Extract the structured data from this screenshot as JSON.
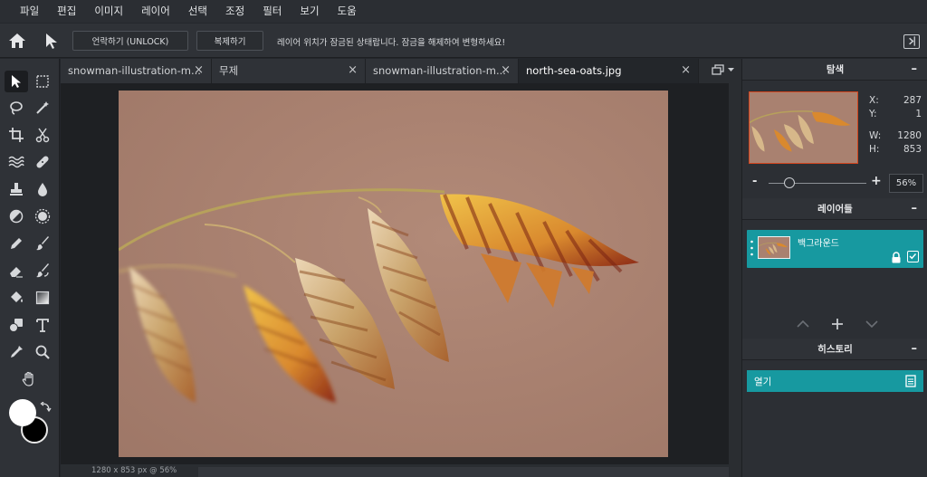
{
  "menu": [
    "파일",
    "편집",
    "이미지",
    "레이어",
    "선택",
    "조정",
    "필터",
    "보기",
    "도움"
  ],
  "options": {
    "unlock_label": "언락하기 (UNLOCK)",
    "duplicate_label": "복제하기",
    "message": "레이어 위치가 잠금된 상태랍니다. 잠금을 해제하여 변형하세요!"
  },
  "tabs": [
    {
      "label": "snowman-illustration-m...",
      "close": "×"
    },
    {
      "label": "무제",
      "close": "×"
    },
    {
      "label": "snowman-illustration-m...",
      "close": "×"
    },
    {
      "label": "north-sea-oats.jpg",
      "close": "×"
    }
  ],
  "active_tab": 3,
  "tools": [
    "move-tool",
    "marquee-tool",
    "lasso-tool",
    "magic-wand-tool",
    "crop-tool",
    "slice-tool",
    "liquify-tool",
    "healing-tool",
    "stamp-tool",
    "blur-tool",
    "dodge-tool",
    "sponge-tool",
    "pencil-tool",
    "brush-tool",
    "eraser-tool",
    "color-replace-tool",
    "fill-tool",
    "gradient-tool",
    "shape-tool",
    "text-tool",
    "eyedropper-tool",
    "zoom-tool",
    "hand-tool"
  ],
  "colors": {
    "foreground": "#ffffff",
    "background": "#000000",
    "accent": "#1799a0",
    "navigator_frame": "#d2451e"
  },
  "navigator": {
    "title": "탐색",
    "x_label": "X:",
    "x_value": "287",
    "y_label": "Y:",
    "y_value": "1",
    "w_label": "W:",
    "w_value": "1280",
    "h_label": "H:",
    "h_value": "853",
    "zoom_minus": "-",
    "zoom_plus": "+",
    "zoom_value": "56%"
  },
  "layers": {
    "title": "레이어들",
    "items": [
      {
        "name": "백그라운드",
        "locked": true,
        "visible": true
      }
    ]
  },
  "history": {
    "title": "히스토리",
    "items": [
      {
        "label": "열기"
      }
    ]
  },
  "status": {
    "text": "1280 x 853 px @ 56%"
  }
}
